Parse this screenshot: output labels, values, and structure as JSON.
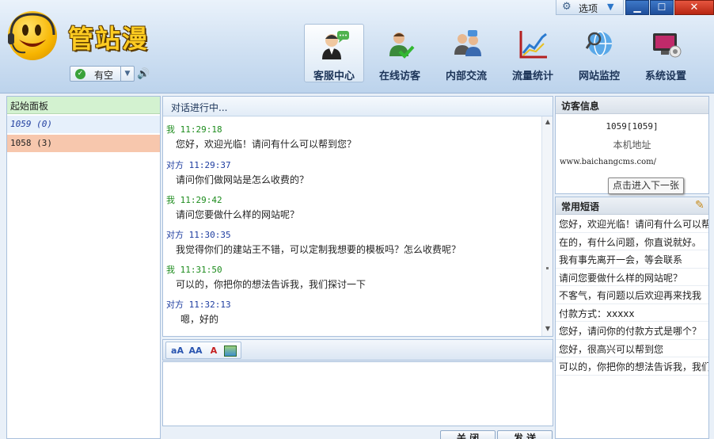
{
  "header": {
    "logo_text": "管站漫",
    "status": "有空",
    "options_label": "选项",
    "window_buttons": {
      "minimize": "▁",
      "maximize": "☐",
      "close": "✕"
    },
    "nav": [
      {
        "label": "客服中心",
        "icon": "customer-service-icon"
      },
      {
        "label": "在线访客",
        "icon": "online-visitors-icon"
      },
      {
        "label": "内部交流",
        "icon": "internal-chat-icon"
      },
      {
        "label": "流量统计",
        "icon": "traffic-stats-icon"
      },
      {
        "label": "网站监控",
        "icon": "site-monitor-icon"
      },
      {
        "label": "系统设置",
        "icon": "system-settings-icon"
      }
    ]
  },
  "left_panel": {
    "title": "起始面板",
    "sessions": [
      {
        "label": "1059 (0)"
      },
      {
        "label": "1058 (3)"
      }
    ]
  },
  "chat": {
    "title": "对话进行中...",
    "messages": [
      {
        "speaker": "我",
        "time": "11:29:18",
        "text": "您好，欢迎光临！请问有什么可以帮到您？"
      },
      {
        "speaker": "对方",
        "time": "11:29:37",
        "text": "请问你们做网站是怎么收费的？"
      },
      {
        "speaker": "我",
        "time": "11:29:42",
        "text": "请问您要做什么样的网站呢？"
      },
      {
        "speaker": "对方",
        "time": "11:30:35",
        "text": "我觉得你们的建站王不错，可以定制我想要的模板吗？怎么收费呢？"
      },
      {
        "speaker": "我",
        "time": "11:31:50",
        "text": "可以的，你把你的想法告诉我，我们探讨一下"
      },
      {
        "speaker": "对方",
        "time": "11:32:13",
        "text": "嗯，好的"
      }
    ],
    "actions": {
      "close": "关 闭",
      "send": "发 送"
    }
  },
  "visitor_info": {
    "title": "访客信息",
    "id": "1059[1059]",
    "location": "本机地址",
    "url": "www.baichangcms.com/",
    "tooltip": "点击进入下一张"
  },
  "phrases": {
    "title": "常用短语",
    "items": [
      "您好，欢迎光临！请问有什么可以帮",
      "在的，有什么问题，你直说就好。",
      "我有事先离开一会，等会联系",
      "请问您要做什么样的网站呢？",
      "不客气，有问题以后欢迎再来找我",
      "付款方式：xxxxx",
      "您好，请问你的付款方式是哪个？",
      "您好，很高兴可以帮到您",
      "可以的，你把你的想法告诉我，我们"
    ]
  }
}
